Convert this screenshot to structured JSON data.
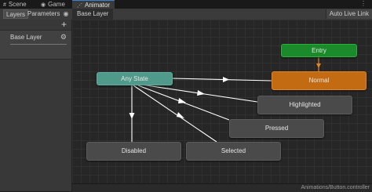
{
  "tabs": [
    {
      "icon": "scene-icon",
      "glyph": "#",
      "label": "Scene"
    },
    {
      "icon": "game-icon",
      "glyph": "◉",
      "label": "Game"
    },
    {
      "icon": "animator-icon",
      "glyph": "⋰",
      "label": "Animator"
    }
  ],
  "toolbar": {
    "layers_label": "Layers",
    "parameters_label": "Parameters",
    "breadcrumb": "Base Layer",
    "auto_live_link": "Auto Live Link"
  },
  "layers": [
    {
      "name": "Base Layer"
    }
  ],
  "states": {
    "entry": "Entry",
    "normal": "Normal",
    "any_state": "Any State",
    "highlighted": "Highlighted",
    "pressed": "Pressed",
    "disabled": "Disabled",
    "selected": "Selected"
  },
  "colors": {
    "entry": "#1b8a2a",
    "default_state": "#c36b12",
    "any_state": "#4f9a8a",
    "state": "#4a4a4a",
    "transition": "#ffffff",
    "default_transition": "#e08628"
  },
  "status": {
    "path": "Animations/Button.controller"
  }
}
